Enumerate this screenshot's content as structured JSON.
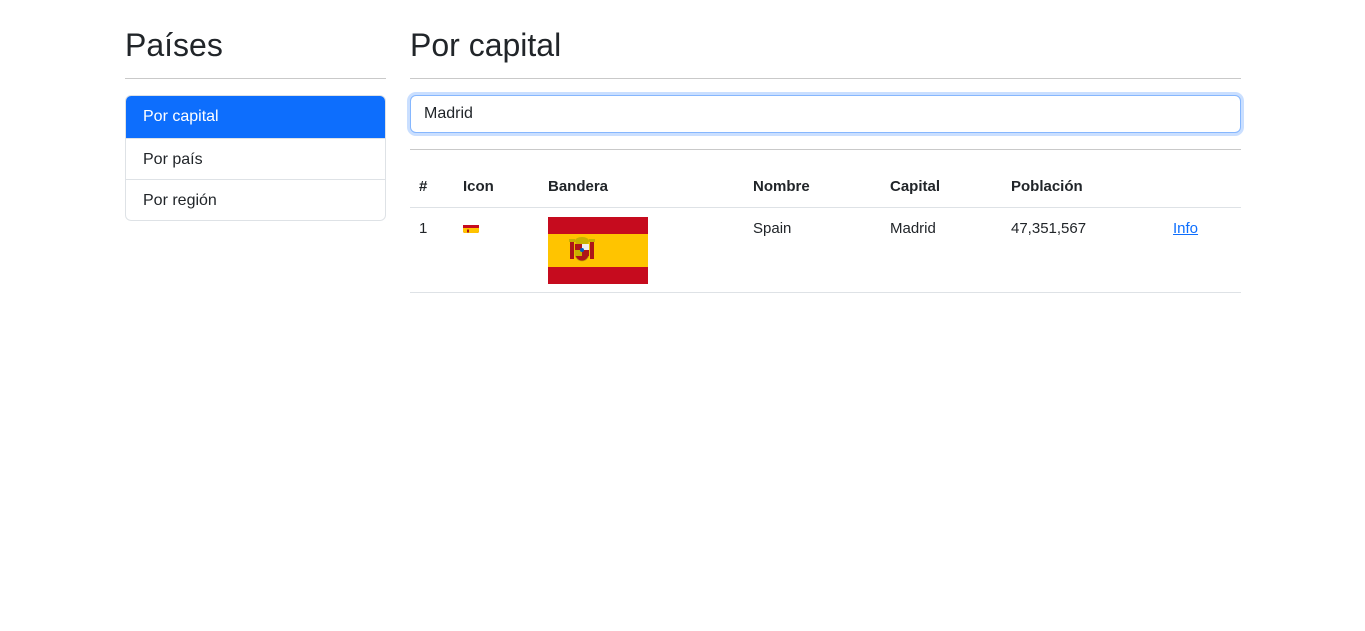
{
  "sidebar": {
    "title": "Países",
    "items": [
      {
        "label": "Por capital",
        "active": true
      },
      {
        "label": "Por país",
        "active": false
      },
      {
        "label": "Por región",
        "active": false
      }
    ]
  },
  "main": {
    "title": "Por capital",
    "search": {
      "value": "Madrid"
    },
    "table": {
      "headers": [
        "#",
        "Icon",
        "Bandera",
        "Nombre",
        "Capital",
        "Población",
        ""
      ],
      "rows": [
        {
          "index": "1",
          "icon": "flag-spain-icon",
          "flag": "flag-spain",
          "nombre": "Spain",
          "capital": "Madrid",
          "poblacion": "47,351,567",
          "link": "Info"
        }
      ]
    }
  },
  "colors": {
    "accent": "#0d6efd",
    "flag_red": "#c60b1e",
    "flag_yellow": "#ffc400"
  }
}
